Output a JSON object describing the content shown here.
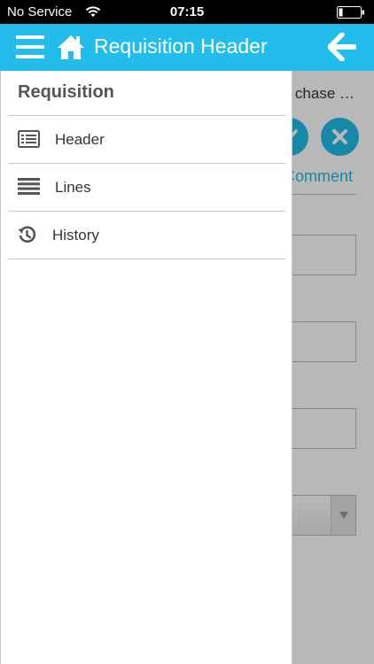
{
  "status_bar": {
    "carrier": "No Service",
    "time": "07:15",
    "icons": [
      "wifi-icon",
      "battery-icon"
    ]
  },
  "nav_bar": {
    "title": "Requisition Header",
    "background_color": "#22bdea",
    "icons": [
      "menu-icon",
      "home-icon",
      "back-arrow-icon"
    ]
  },
  "background_screen": {
    "subtitle_fragment": "chase …",
    "comment_link": "Comment",
    "buttons": [
      "approve-check-icon",
      "reject-x-icon"
    ]
  },
  "drawer": {
    "title": "Requisition",
    "items": [
      {
        "label": "Header",
        "icon": "header-list-icon"
      },
      {
        "label": "Lines",
        "icon": "lines-icon"
      },
      {
        "label": "History",
        "icon": "history-icon"
      }
    ]
  }
}
